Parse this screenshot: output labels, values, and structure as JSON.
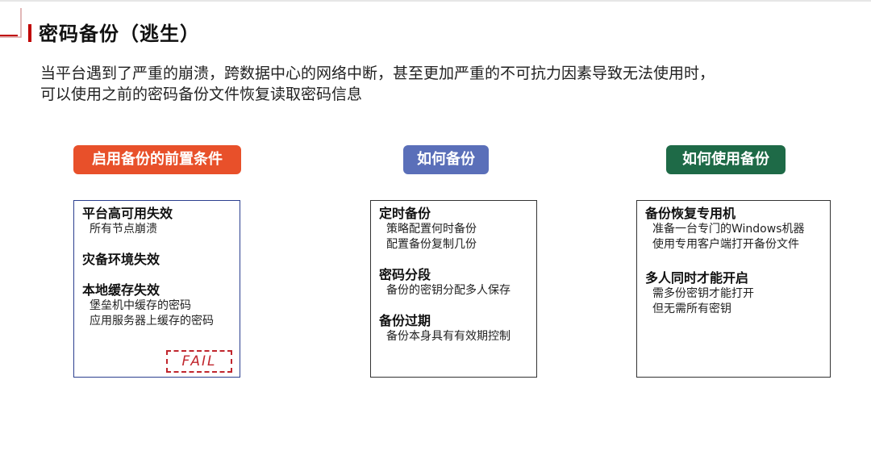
{
  "page": {
    "title": "密码备份（逃生）",
    "intro_lines": [
      "当平台遇到了严重的崩溃，跨数据中心的网络中断，甚至更加严重的不可抗力因素导致无法使用时，",
      "可以使用之前的密码备份文件恢复读取密码信息"
    ]
  },
  "colors": {
    "accent_red": "#c00000",
    "pill_prerequisites": "#e8502a",
    "pill_how_backup": "#5a6fb9",
    "pill_how_use": "#1e6a47",
    "stamp_red": "#c0262d"
  },
  "columns": [
    {
      "pill": "启用备份的前置条件",
      "groups": [
        {
          "head": "平台高可用失效",
          "items": [
            "所有节点崩溃"
          ]
        },
        {
          "head": "灾备环境失效",
          "items": []
        },
        {
          "head": "本地缓存失效",
          "items": [
            "堡垒机中缓存的密码",
            "应用服务器上缓存的密码"
          ]
        }
      ],
      "stamp": "FAIL"
    },
    {
      "pill": "如何备份",
      "groups": [
        {
          "head": "定时备份",
          "items": [
            "策略配置何时备份",
            "配置备份复制几份"
          ]
        },
        {
          "head": "密码分段",
          "items": [
            "备份的密钥分配多人保存"
          ]
        },
        {
          "head": "备份过期",
          "items": [
            "备份本身具有有效期控制"
          ]
        }
      ]
    },
    {
      "pill": "如何使用备份",
      "groups": [
        {
          "head": "备份恢复专用机",
          "items": [
            "准备一台专门的Windows机器",
            "使用专用客户端打开备份文件"
          ]
        },
        {
          "head": "多人同时才能开启",
          "items": [
            "需多份密钥才能打开",
            "但无需所有密钥"
          ]
        }
      ]
    }
  ]
}
